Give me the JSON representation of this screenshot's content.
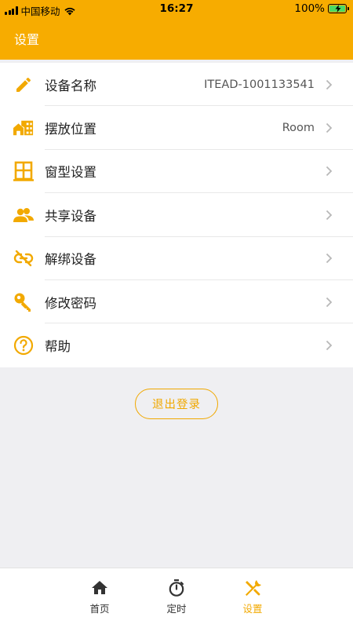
{
  "status_bar": {
    "carrier": "中国移动",
    "time": "16:27",
    "battery_percent": "100%"
  },
  "header": {
    "title": "设置"
  },
  "settings": {
    "items": [
      {
        "label": "设备名称",
        "value": "ITEAD-1001133541",
        "icon": "pencil-icon"
      },
      {
        "label": "摆放位置",
        "value": "Room",
        "icon": "building-icon"
      },
      {
        "label": "窗型设置",
        "value": "",
        "icon": "window-icon"
      },
      {
        "label": "共享设备",
        "value": "",
        "icon": "people-icon"
      },
      {
        "label": "解绑设备",
        "value": "",
        "icon": "link-off-icon"
      },
      {
        "label": "修改密码",
        "value": "",
        "icon": "key-icon"
      },
      {
        "label": "帮助",
        "value": "",
        "icon": "help-icon"
      }
    ]
  },
  "logout": {
    "label": "退出登录"
  },
  "tabbar": {
    "tabs": [
      {
        "label": "首页",
        "icon": "home-icon",
        "active": false
      },
      {
        "label": "定时",
        "icon": "timer-icon",
        "active": false
      },
      {
        "label": "设置",
        "icon": "tools-icon",
        "active": true
      }
    ]
  },
  "colors": {
    "accent": "#f7ac00",
    "icon": "#f2a900",
    "background": "#efeff2",
    "tab_inactive": "#333333"
  }
}
